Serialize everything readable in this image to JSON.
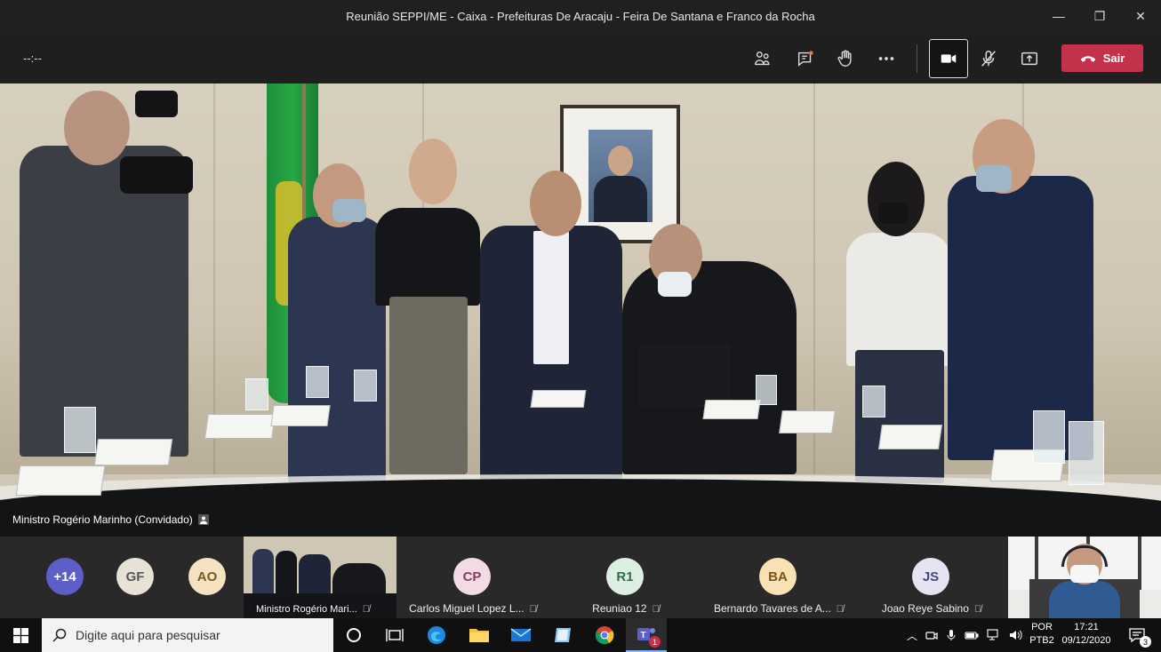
{
  "window": {
    "title": "Reunião SEPPI/ME - Caixa - Prefeituras De Aracaju - Feira De Santana e Franco da Rocha",
    "minimize": "—",
    "maximize": "❐",
    "close": "✕"
  },
  "toolbar": {
    "timer": "--:--",
    "leave_label": "Sair"
  },
  "stage": {
    "speaker_label": "Ministro Rogério Marinho (Convidado)"
  },
  "participants": {
    "overflow_count": "+14",
    "avatars": [
      {
        "initials": "GF",
        "bg": "#e8e2d6",
        "fg": "#555"
      },
      {
        "initials": "AO",
        "bg": "#f5e2c1",
        "fg": "#7a5a21"
      }
    ],
    "video_tile_name": "Ministro Rogério Mari...",
    "tiles": [
      {
        "initials": "CP",
        "name": "Carlos Miguel Lopez L...",
        "bg": "#f2dbe4",
        "fg": "#8a3c5c"
      },
      {
        "initials": "R1",
        "name": "Reuniao 12",
        "bg": "#dcefe3",
        "fg": "#2f6f46"
      },
      {
        "initials": "BA",
        "name": "Bernardo Tavares de A...",
        "bg": "#f7e1b5",
        "fg": "#7a5418"
      },
      {
        "initials": "JS",
        "name": "Joao Reye Sabino",
        "bg": "#e4e4f2",
        "fg": "#46467a"
      }
    ]
  },
  "taskbar": {
    "search_placeholder": "Digite aqui para pesquisar",
    "lang_top": "POR",
    "lang_bottom": "PTB2",
    "time": "17:21",
    "date": "09/12/2020",
    "notification_count": "3",
    "teams_badge": "1"
  }
}
